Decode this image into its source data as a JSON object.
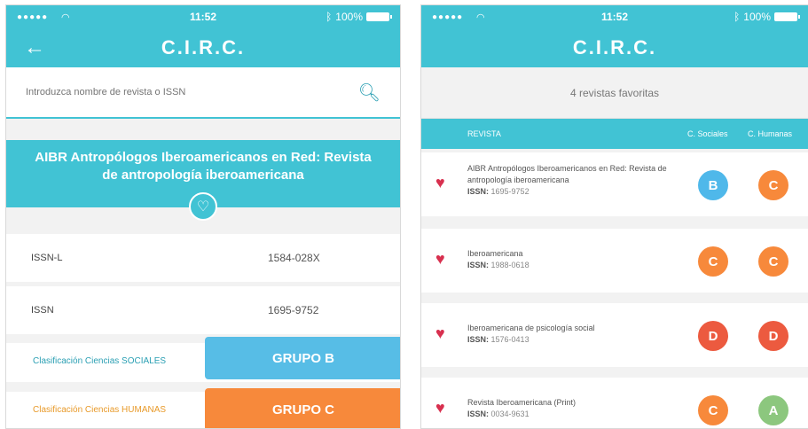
{
  "colors": {
    "accent": "#41c3d4",
    "grupo_b": "#57bde6",
    "grupo_c": "#f7893b",
    "sociales_label": "#2a9fb3",
    "humanas_label": "#e89a2a",
    "heart": "#d8304f",
    "grade_B": "#4fb8ea",
    "grade_C": "#f7893b",
    "grade_D": "#ec5a3f",
    "grade_A": "#8cc77e"
  },
  "left": {
    "status": {
      "signal": "●●●●●",
      "time": "11:52",
      "battery": "100%"
    },
    "app_title": "C.I.R.C.",
    "back_icon": "arrow-left-icon",
    "search": {
      "placeholder": "Introduzca nombre de revista o ISSN",
      "icon": "search-icon"
    },
    "journal_title": "AIBR Antropólogos Iberoamericanos en Red: Revista de antropología iberoamericana",
    "favorite_icon": "heart-outline-icon",
    "rows": [
      {
        "label": "ISSN-L",
        "value": "1584-028X"
      },
      {
        "label": "ISSN",
        "value": "1695-9752"
      }
    ],
    "classification": [
      {
        "label": "Clasificación Ciencias SOCIALES",
        "group": "GRUPO B"
      },
      {
        "label": "Clasificación Ciencias HUMANAS",
        "group": "GRUPO C"
      }
    ]
  },
  "right": {
    "status": {
      "signal": "●●●●●",
      "time": "11:52",
      "battery": "100%"
    },
    "app_title": "C.I.R.C.",
    "favorites_count": "4 revistas favoritas",
    "columns": {
      "revista": "REVISTA",
      "sociales": "C. Sociales",
      "humanas": "C. Humanas"
    },
    "issn_label": "ISSN:",
    "items": [
      {
        "name": "AIBR Antropólogos Iberoamericanos en Red: Revista de antropología iberoamericana",
        "issn": "1695-9752",
        "sociales": "B",
        "humanas": "C"
      },
      {
        "name": "Iberoamericana",
        "issn": "1988-0618",
        "sociales": "C",
        "humanas": "C"
      },
      {
        "name": "Iberoamericana de psicología social",
        "issn": "1576-0413",
        "sociales": "D",
        "humanas": "D"
      },
      {
        "name": "Revista Iberoamericana (Print)",
        "issn": "0034-9631",
        "sociales": "C",
        "humanas": "A"
      }
    ]
  }
}
